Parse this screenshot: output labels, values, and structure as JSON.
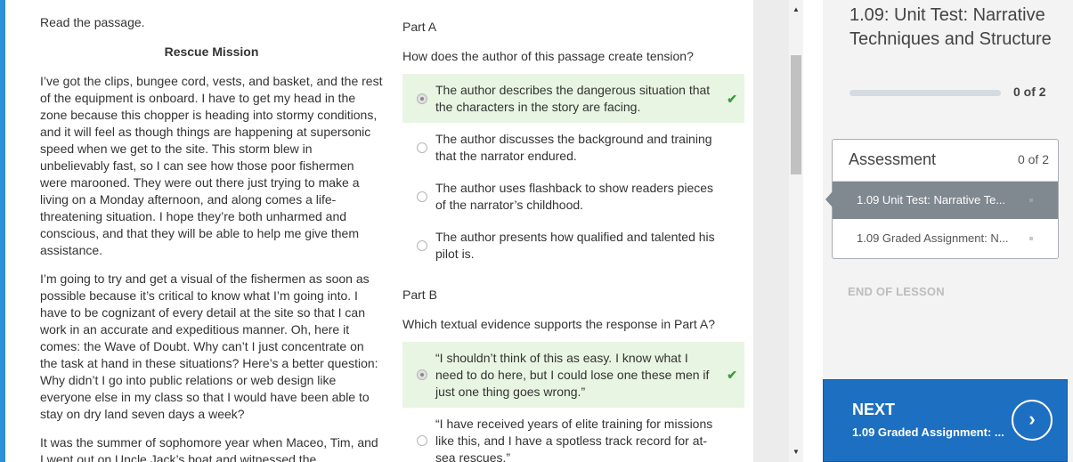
{
  "passage": {
    "instruction": "Read the passage.",
    "title": "Rescue Mission",
    "paragraphs": [
      "I’ve got the clips, bungee cord, vests, and basket, and the rest of the equipment is onboard. I have to get my head in the zone because this chopper is heading into stormy conditions, and it will feel as though things are happening at supersonic speed when we get to the site. This storm blew in unbelievably fast, so I can see how those poor fishermen were marooned. They were out there just trying to make a living on a Monday afternoon, and along comes a life-threatening situation. I hope they’re both unharmed and conscious, and that they will be able to help me give them assistance.",
      "I’m going to try and get a visual of the fishermen as soon as possible because it’s critical to know what I’m going into. I have to be cognizant of every detail at the site so that I can work in an accurate and expeditious manner. Oh, here it comes: the Wave of Doubt. Why can’t I just concentrate on the task at hand in these situations? Here’s a better question: Why didn’t I go into public relations or web design like everyone else in my class so that I would have been able to stay on dry land seven days a week?",
      "It was the summer of sophomore year when Maceo, Tim, and I went out on Uncle Jack’s boat and witnessed the"
    ]
  },
  "partA": {
    "label": "Part A",
    "question": "How does the author of this passage create tension?",
    "options": [
      "The author describes the dangerous situation that the characters in the story are facing.",
      "The author discusses the background and training that the narrator endured.",
      "The author uses flashback to show readers pieces of the narrator’s childhood.",
      "The author presents how qualified and talented his pilot is."
    ],
    "selected": 0
  },
  "partB": {
    "label": "Part B",
    "question": "Which textual evidence supports the response in Part A?",
    "options": [
      "“I shouldn’t think of this as easy. I know what I need to do here, but I could lose one these men if just one thing goes wrong.”",
      "“I have received years of elite training for missions like this, and I have a spotless track record for at-sea rescues.”"
    ],
    "selected": 0
  },
  "check_icon": "checkmark-icon",
  "sidebar": {
    "lesson_title": "1.09: Unit Test: Narrative Techniques and Structure",
    "progress_text": "0 of 2",
    "progress_fraction": 0,
    "assessment": {
      "title": "Assessment",
      "count": "0 of 2",
      "items": [
        "1.09 Unit Test: Narrative Te...",
        "1.09 Graded Assignment: N..."
      ]
    },
    "end_of_lesson": "END OF LESSON",
    "next": {
      "label": "NEXT",
      "subtitle": "1.09 Graded Assignment: ...",
      "icon": "chevron-right-icon"
    }
  },
  "colors": {
    "accent_blue": "#2f8fd8",
    "next_button": "#1d6fc2",
    "selected_answer_bg": "#e8f5e2",
    "check_green": "#3c9c3c"
  }
}
